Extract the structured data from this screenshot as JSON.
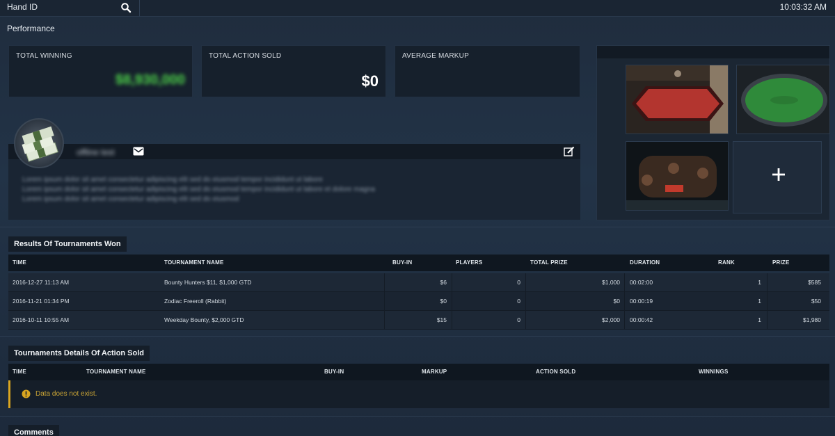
{
  "topbar": {
    "hand_id": "Hand ID",
    "clock": "10:03:32 AM"
  },
  "section_title": "Performance",
  "cards": {
    "total_winning": {
      "title": "TOTAL WINNING",
      "value": "$8,930,000"
    },
    "total_action_sold": {
      "title": "TOTAL ACTION SOLD",
      "value": "$0"
    },
    "average_markup": {
      "title": "AVERAGE MARKUP",
      "value": ""
    }
  },
  "profile": {
    "name": "offline test",
    "bio_lines": [
      "Lorem ipsum dolor sit amet consectetur adipiscing elit sed do eiusmod tempor incididunt ut labore",
      "Lorem ipsum dolor sit amet consectetur adipiscing elit sed do eiusmod tempor incididunt ut labore et dolore magna",
      "Lorem ipsum dolor sit amet consectetur adipiscing elit sed do eiusmod"
    ]
  },
  "gallery": {
    "add_label": "+"
  },
  "tournaments_won": {
    "label": "Results Of Tournaments Won",
    "headers": [
      "TIME",
      "TOURNAMENT NAME",
      "BUY-IN",
      "PLAYERS",
      "TOTAL PRIZE",
      "DURATION",
      "RANK",
      "PRIZE"
    ],
    "rows": [
      [
        "2016-12-27 11:13 AM",
        "Bounty Hunters $11, $1,000 GTD",
        "$6",
        "0",
        "$1,000",
        "00:02:00",
        "1",
        "$585"
      ],
      [
        "2016-11-21 01:34 PM",
        "Zodiac Freeroll (Rabbit)",
        "$0",
        "0",
        "$0",
        "00:00:19",
        "1",
        "$50"
      ],
      [
        "2016-10-11 10:55 AM",
        "Weekday Bounty, $2,000 GTD",
        "$15",
        "0",
        "$2,000",
        "00:00:42",
        "1",
        "$1,980"
      ]
    ]
  },
  "action_sold": {
    "label": "Tournaments Details Of Action Sold",
    "headers": [
      "TIME",
      "TOURNAMENT NAME",
      "BUY-IN",
      "MARKUP",
      "ACTION SOLD",
      "WINNINGS"
    ],
    "empty_message": "Data does not exist."
  },
  "comments": {
    "label": "Comments"
  },
  "colors": {
    "accent_green": "#4fd64a",
    "warning": "#d9a520",
    "felt_red": "#b3352f",
    "felt_green": "#2f8a3a"
  }
}
